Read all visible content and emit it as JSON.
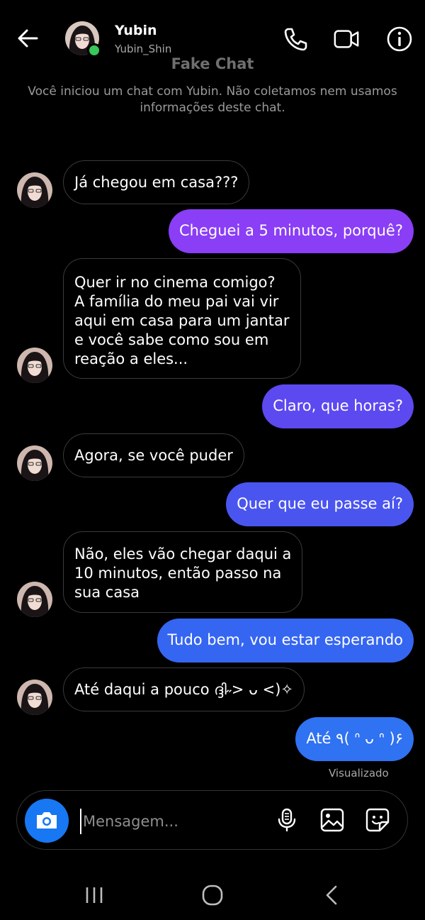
{
  "header": {
    "name": "Yubin",
    "handle": "Yubin_Shin",
    "title": "Fake Chat",
    "notice": "Você iniciou um chat com Yubin. Não coletamos nem usamos informações deste chat."
  },
  "messages": [
    {
      "from": "in",
      "lines": [
        "Já chegou em casa???"
      ]
    },
    {
      "from": "out",
      "lines": [
        "Cheguei a 5 minutos, porquê?"
      ]
    },
    {
      "from": "in",
      "lines": [
        "Quer ir no cinema comigo?",
        "A família do meu pai vai vir",
        "aqui em casa para um jantar",
        "e você sabe como sou em",
        "reação a eles..."
      ]
    },
    {
      "from": "out",
      "lines": [
        "Claro, que horas?"
      ]
    },
    {
      "from": "in",
      "lines": [
        "Agora, se você puder"
      ]
    },
    {
      "from": "out",
      "lines": [
        "Quer que eu passe aí?"
      ]
    },
    {
      "from": "in",
      "lines": [
        "Não, eles vão chegar daqui a",
        "10 minutos, então passo na",
        "sua casa"
      ]
    },
    {
      "from": "out",
      "lines": [
        "Tudo bem, vou estar esperando"
      ]
    },
    {
      "from": "in",
      "lines": [
        "Até daqui a pouco ദ്ദി˶> ᴗ <)✧"
      ]
    },
    {
      "from": "out",
      "lines": [
        "Até ٩( ᐢ ᴗ ᐢ )۶"
      ]
    }
  ],
  "seen_label": "Visualizado",
  "composer": {
    "placeholder": "Mensagem..."
  },
  "colors": {
    "bubble_top": "#8b3df5",
    "bubble_bottom": "#2f72f2",
    "camera": "#1877f2",
    "online": "#38c75a"
  },
  "icons": {
    "back": "arrow-left-icon",
    "call": "phone-icon",
    "video": "video-camera-icon",
    "info": "info-icon",
    "camera": "camera-icon",
    "mic": "microphone-icon",
    "gallery": "image-icon",
    "sticker": "sticker-icon"
  }
}
